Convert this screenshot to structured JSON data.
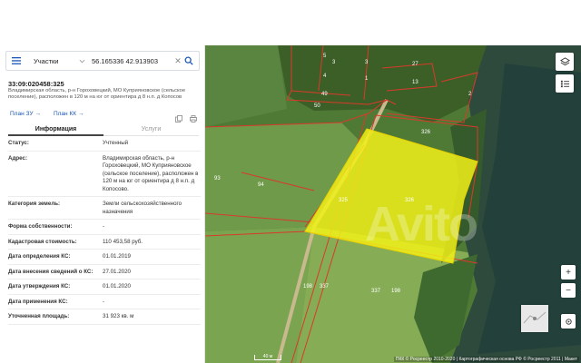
{
  "search": {
    "type_label": "Участки",
    "query": "56.165336 42.913903"
  },
  "parcel": {
    "cadastral_number": "33:09:020458:325",
    "address_line": "Владимирская область, р-н Гороховецкий, МО Куприяновское (сельское поселение), расположен в 120 м на юг от ориентира д 8 н.п. д Копосов",
    "plan_zu": "План ЗУ",
    "plan_kk": "План КК"
  },
  "tabs": {
    "info": "Информация",
    "services": "Услуги"
  },
  "rows": [
    {
      "label": "Статус:",
      "value": "Учтенный"
    },
    {
      "label": "Адрес:",
      "value": "Владимирская область, р-н Гороховецкий, МО Куприяновское (сельское поселение), расположен в 120 м на юг от ориентира д 8 н.п. д Копосово."
    },
    {
      "label": "Категория земель:",
      "value": "Земли сельскохозяйственного назначения"
    },
    {
      "label": "Форма собственности:",
      "value": "-"
    },
    {
      "label": "Кадастровая стоимость:",
      "value": "110 453,58 руб."
    },
    {
      "label": "Дата определения КС:",
      "value": "01.01.2019"
    },
    {
      "label": "Дата внесения сведений о КС:",
      "value": "27.01.2020"
    },
    {
      "label": "Дата утверждения КС:",
      "value": "01.01.2020"
    },
    {
      "label": "Дата применения КС:",
      "value": "-"
    },
    {
      "label": "Уточненная площадь:",
      "value": "31 923 кв. м"
    }
  ],
  "map": {
    "attribution": "ПКК © Росреестр 2010-2020 | Картографическая основа РФ © Росреестр 2011 | Макет",
    "scale_label": "40 м",
    "watermark": "Avito",
    "highlight_color": "#f1f117",
    "parcel_labels": [
      "325",
      "326",
      "93",
      "94",
      "198",
      "337",
      "337",
      "198",
      "49",
      "50",
      "27",
      "13",
      "5",
      "3",
      "4",
      "1",
      "2",
      "3"
    ]
  }
}
